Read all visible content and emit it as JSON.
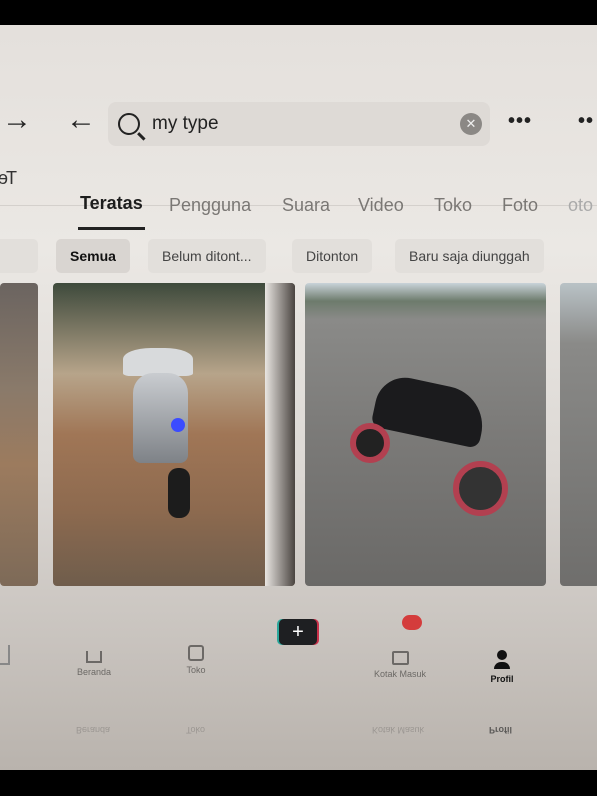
{
  "search": {
    "query": "my type",
    "clear_icon": "close-icon"
  },
  "tabs": [
    {
      "label": "Teratas",
      "active": true
    },
    {
      "label": "Pengguna"
    },
    {
      "label": "Suara"
    },
    {
      "label": "Video"
    },
    {
      "label": "Toko"
    },
    {
      "label": "Foto"
    }
  ],
  "chips": [
    {
      "label": "Semua",
      "selected": true
    },
    {
      "label": "Belum ditont..."
    },
    {
      "label": "Ditonton"
    },
    {
      "label": "Baru saja diunggah"
    }
  ],
  "results": [
    {
      "description_icon": "scooter-photo"
    },
    {
      "description_icon": "motorbike-photo"
    }
  ],
  "nav": {
    "home": "Beranda",
    "shop": "Toko",
    "create": "+",
    "inbox": "Kotak Masuk",
    "profile": "Profil"
  },
  "colors": {
    "accent_red": "#d43c3c",
    "create_teal": "#2aa79b",
    "create_pink": "#c9304a"
  }
}
